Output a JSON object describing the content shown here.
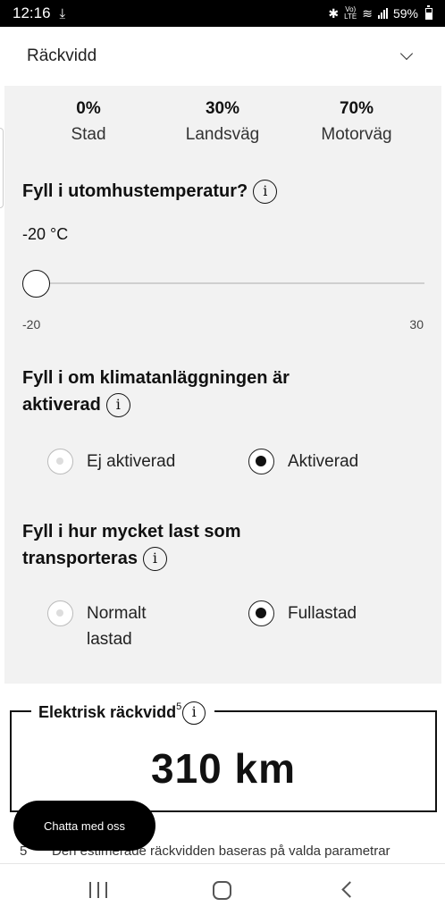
{
  "status_bar": {
    "time": "12:16",
    "battery": "59%",
    "network": "LTE"
  },
  "header": {
    "title": "Räckvidd"
  },
  "driving_split": [
    {
      "percent": "0%",
      "label": "Stad"
    },
    {
      "percent": "30%",
      "label": "Landsväg"
    },
    {
      "percent": "70%",
      "label": "Motorväg"
    }
  ],
  "temperature": {
    "question": "Fyll i utomhustemperatur?",
    "value": "-20 °C",
    "min": "-20",
    "max": "30",
    "slider_position": 0
  },
  "climate": {
    "question_line1": "Fyll i om klimatanläggningen är",
    "question_line2": "aktiverad",
    "options": [
      {
        "label": "Ej aktiverad",
        "selected": false
      },
      {
        "label": "Aktiverad",
        "selected": true
      }
    ]
  },
  "load": {
    "question_line1": "Fyll i hur mycket last som",
    "question_line2": "transporteras",
    "options": [
      {
        "label_line1": "Normalt",
        "label_line2": "lastad",
        "selected": false
      },
      {
        "label": "Fullastad",
        "selected": true
      }
    ]
  },
  "result": {
    "label": "Elektrisk räckvidd",
    "footnote_ref": "5",
    "value": "310 km"
  },
  "info_symbol": "i",
  "footnote": {
    "number": "5",
    "text": "Den estimerade räckvidden baseras på valda parametrar"
  },
  "chat_button": {
    "label": "Chatta med oss"
  },
  "colors": {
    "panel_bg": "#f2f2f2",
    "accent": "#111111"
  }
}
